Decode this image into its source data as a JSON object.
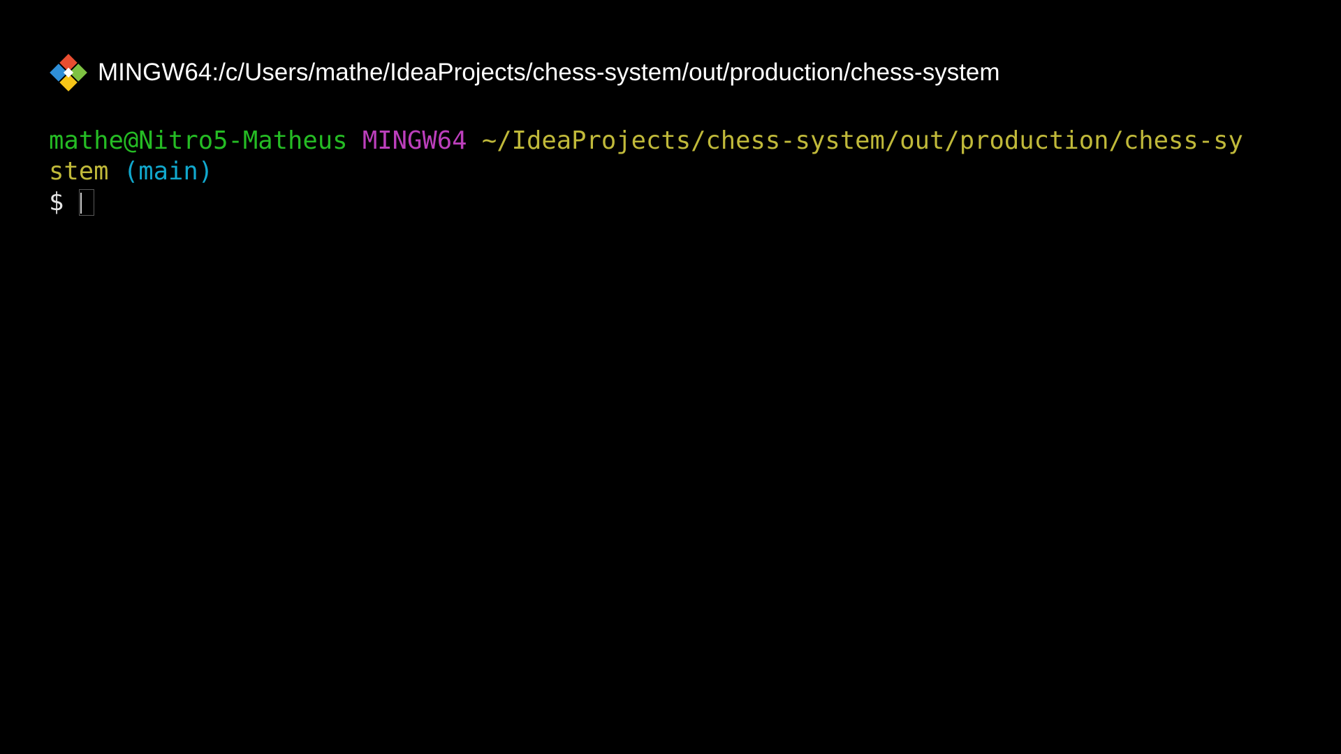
{
  "window": {
    "title": "MINGW64:/c/Users/mathe/IdeaProjects/chess-system/out/production/chess-system",
    "icon": "git-bash-icon"
  },
  "terminal": {
    "prompt": {
      "user_host": "mathe@Nitro5-Matheus",
      "system": "MINGW64",
      "path_line1": "~/IdeaProjects/chess-system/out/production/chess-sy",
      "path_line2": "stem",
      "branch": "(main)",
      "symbol": "$"
    },
    "input_value": ""
  },
  "colors": {
    "background": "#000000",
    "user_host": "#25bc24",
    "system": "#bc3fbc",
    "path": "#c0b93a",
    "branch": "#11a8cd",
    "text": "#ffffff"
  }
}
